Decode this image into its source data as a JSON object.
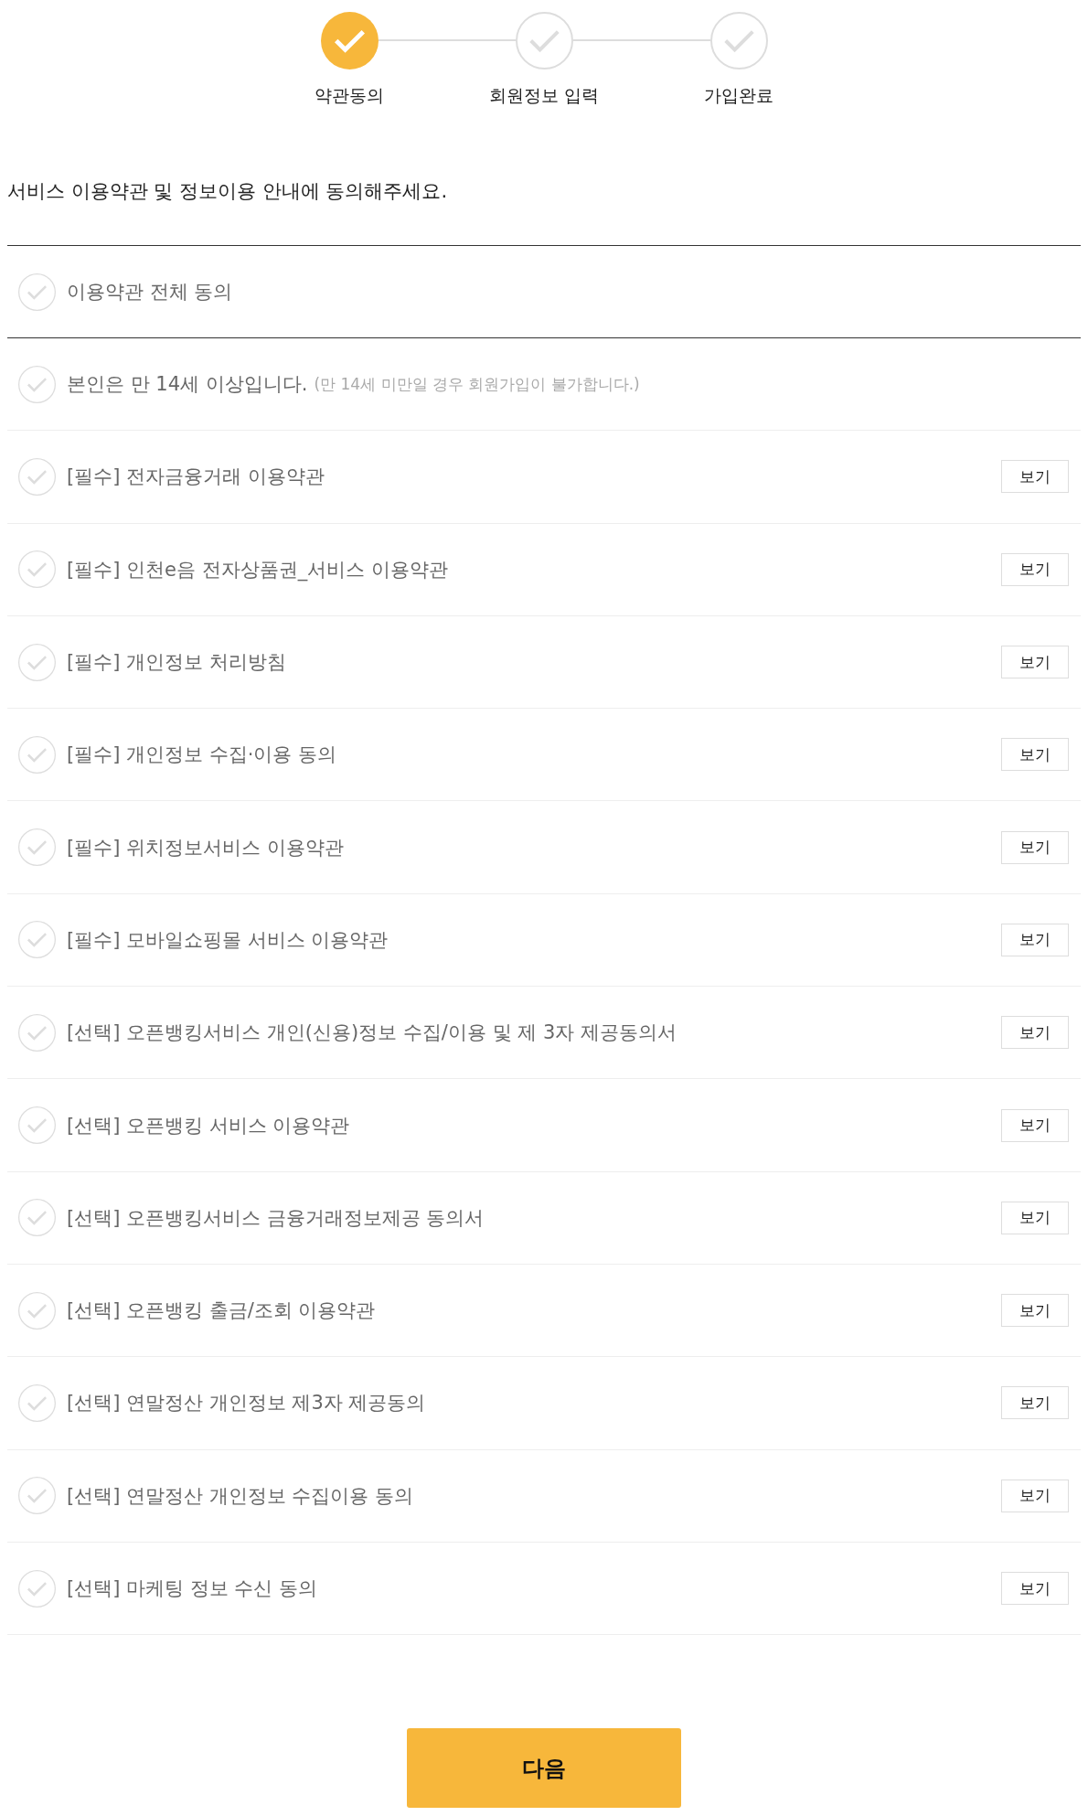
{
  "steps": [
    {
      "label": "약관동의",
      "selected": true
    },
    {
      "label": "회원정보 입력",
      "selected": false
    },
    {
      "label": "가입완료",
      "selected": false
    }
  ],
  "instruction": "서비스 이용약관 및 정보이용 안내에 동의해주세요.",
  "agree_all": {
    "label": "이용약관 전체 동의",
    "checked": false
  },
  "terms": [
    {
      "label": "본인은 만 14세 이상입니다.",
      "note": "(만 14세 미만일 경우 회원가입이 불가합니다.)",
      "checked": false
    },
    {
      "label": "[필수] 전자금융거래 이용약관",
      "checked": false,
      "view_button": "보기"
    },
    {
      "label": "[필수] 인천e음 전자상품권_서비스 이용약관",
      "checked": false,
      "view_button": "보기"
    },
    {
      "label": "[필수] 개인정보 처리방침",
      "checked": false,
      "view_button": "보기"
    },
    {
      "label": "[필수] 개인정보 수집·이용 동의",
      "checked": false,
      "view_button": "보기"
    },
    {
      "label": "[필수] 위치정보서비스 이용약관",
      "checked": false,
      "view_button": "보기"
    },
    {
      "label": "[필수] 모바일쇼핑몰 서비스 이용약관",
      "checked": false,
      "view_button": "보기"
    },
    {
      "label": "[선택] 오픈뱅킹서비스 개인(신용)정보 수집/이용 및 제 3자 제공동의서",
      "checked": false,
      "view_button": "보기"
    },
    {
      "label": "[선택] 오픈뱅킹 서비스 이용약관",
      "checked": false,
      "view_button": "보기"
    },
    {
      "label": "[선택] 오픈뱅킹서비스 금융거래정보제공 동의서",
      "checked": false,
      "view_button": "보기"
    },
    {
      "label": "[선택] 오픈뱅킹 출금/조회 이용약관",
      "checked": false,
      "view_button": "보기"
    },
    {
      "label": "[선택] 연말정산 개인정보 제3자 제공동의",
      "checked": false,
      "view_button": "보기"
    },
    {
      "label": "[선택] 연말정산 개인정보 수집이용 동의",
      "checked": false,
      "view_button": "보기"
    },
    {
      "label": "[선택] 마케팅 정보 수신 동의",
      "checked": false,
      "view_button": "보기"
    }
  ],
  "next_button": "다음"
}
